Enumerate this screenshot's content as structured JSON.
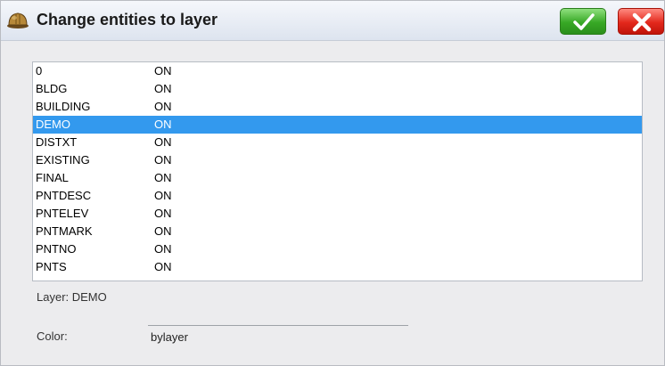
{
  "window": {
    "title": "Change entities to layer",
    "ok_icon": "checkmark-icon",
    "cancel_icon": "close-icon",
    "app_icon": "hardhat-icon"
  },
  "layers": [
    {
      "name": "0",
      "state": "ON",
      "selected": false
    },
    {
      "name": "BLDG",
      "state": "ON",
      "selected": false
    },
    {
      "name": "BUILDING",
      "state": "ON",
      "selected": false
    },
    {
      "name": "DEMO",
      "state": "ON",
      "selected": true
    },
    {
      "name": "DISTXT",
      "state": "ON",
      "selected": false
    },
    {
      "name": "EXISTING",
      "state": "ON",
      "selected": false
    },
    {
      "name": "FINAL",
      "state": "ON",
      "selected": false
    },
    {
      "name": "PNTDESC",
      "state": "ON",
      "selected": false
    },
    {
      "name": "PNTELEV",
      "state": "ON",
      "selected": false
    },
    {
      "name": "PNTMARK",
      "state": "ON",
      "selected": false
    },
    {
      "name": "PNTNO",
      "state": "ON",
      "selected": false
    },
    {
      "name": "PNTS",
      "state": "ON",
      "selected": false
    }
  ],
  "info": {
    "layer_text": "Layer: DEMO",
    "color_label": "Color:",
    "color_value": "bylayer"
  },
  "colors": {
    "selection": "#3399ee",
    "ok_button": "#37a825",
    "cancel_button": "#e3281c"
  }
}
